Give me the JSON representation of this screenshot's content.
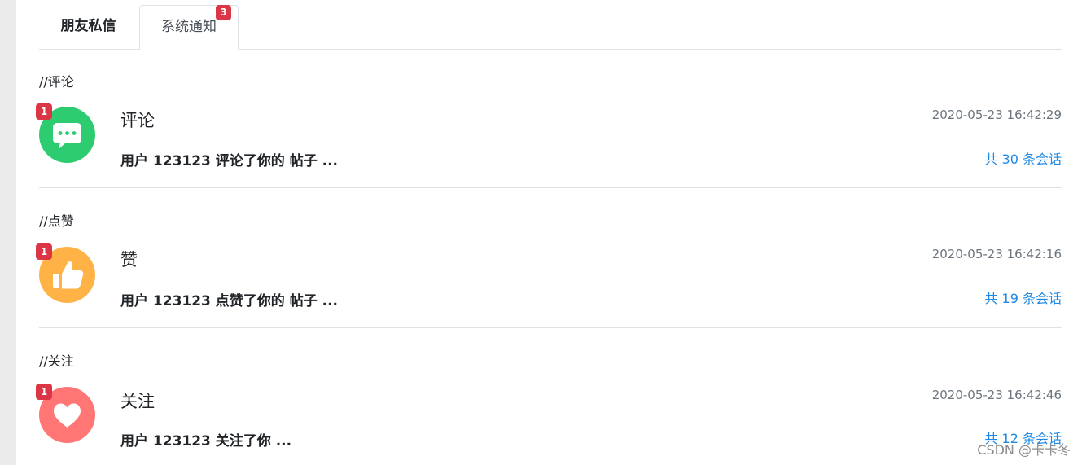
{
  "tabs": {
    "friends_label": "朋友私信",
    "system_label": "系统通知",
    "system_badge": "3"
  },
  "sections": [
    {
      "label": "//评论",
      "badge": "1",
      "icon": "comment-icon",
      "title": "评论",
      "desc": "用户 123123 评论了你的 帖子 ...",
      "time": "2020-05-23 16:42:29",
      "count": "共 30 条会话",
      "color": "#2ecc71"
    },
    {
      "label": "//点赞",
      "badge": "1",
      "icon": "thumbs-up-icon",
      "title": "赞",
      "desc": "用户 123123 点赞了你的 帖子 ...",
      "time": "2020-05-23 16:42:16",
      "count": "共 19 条会话",
      "color": "#ffb347"
    },
    {
      "label": "//关注",
      "badge": "1",
      "icon": "heart-icon",
      "title": "关注",
      "desc": "用户 123123 关注了你 ...",
      "time": "2020-05-23 16:42:46",
      "count": "共 12 条会话",
      "color": "#ff7675"
    }
  ],
  "watermark": "CSDN @卡卡冬",
  "colors": {
    "badge": "#dc3545",
    "link": "#1e88e5",
    "divider": "#dee2e6"
  }
}
